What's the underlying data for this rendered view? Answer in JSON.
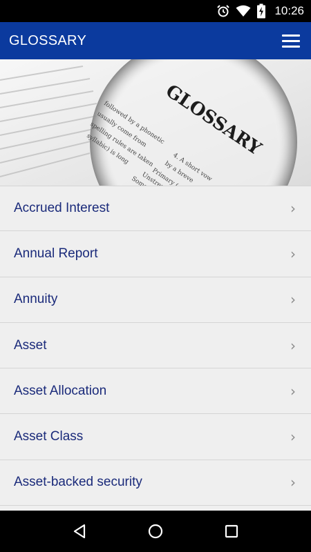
{
  "status_bar": {
    "time": "10:26",
    "icons": [
      "alarm-icon",
      "wifi-icon",
      "battery-charging-icon"
    ]
  },
  "app_bar": {
    "title": "GLOSSARY",
    "menu_icon": "hamburger-menu-icon"
  },
  "hero": {
    "heading": "GLOSSARY",
    "text_snippets": [
      "followed by a phonetic",
      "usually come from",
      "spelling rules are taken",
      "syllabic) is long",
      "4. A short vow",
      "by a breve",
      "Primary (",
      "Unstresse",
      "Some"
    ]
  },
  "glossary": {
    "items": [
      {
        "label": "Accrued Interest"
      },
      {
        "label": "Annual Report"
      },
      {
        "label": "Annuity"
      },
      {
        "label": "Asset"
      },
      {
        "label": "Asset Allocation"
      },
      {
        "label": "Asset Class"
      },
      {
        "label": "Asset-backed security"
      }
    ],
    "chevron_glyph": "›"
  },
  "nav_bar": {
    "buttons": [
      "back-icon",
      "home-icon",
      "recents-icon"
    ]
  }
}
